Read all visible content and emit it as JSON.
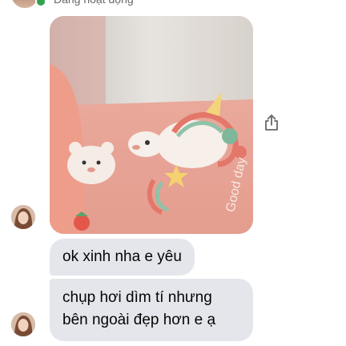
{
  "header": {
    "status_text": "Đang hoạt động",
    "online_color": "#31a24c"
  },
  "conversation": {
    "photo": {
      "icon": "image-attachment",
      "dominant_color": "#e8b7ae"
    },
    "share_icon": "share-icon",
    "messages": [
      {
        "lines": [
          "ok xinh nha e yêu"
        ]
      },
      {
        "lines": [
          "chụp hơi dìm tí nhưng",
          "bên ngoài đẹp hơn e ạ"
        ]
      }
    ],
    "bubble_color": "#e4e6eb",
    "text_color": "#050505"
  }
}
